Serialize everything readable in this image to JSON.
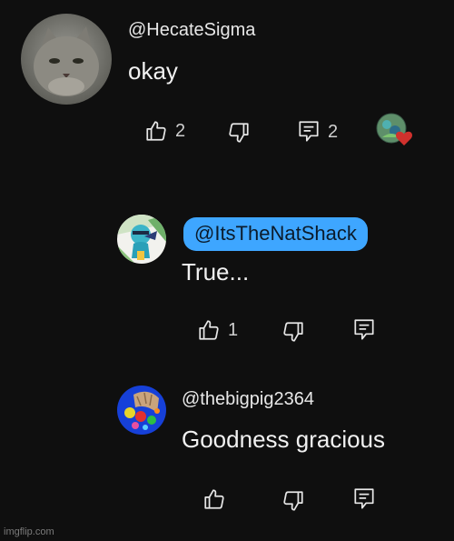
{
  "comments": [
    {
      "handle": "@HecateSigma",
      "text": "okay",
      "likes": "2",
      "replies": "2",
      "avatar": "cat-photo"
    },
    {
      "handle": "@ItsTheNatShack",
      "text": "True...",
      "likes": "1",
      "avatar": "cartoon-character"
    },
    {
      "handle": "@thebigpig2364",
      "text": "Goodness gracious",
      "likes": "",
      "avatar": "dots-and-creature"
    }
  ],
  "icons": {
    "like": "thumbs-up-icon",
    "dislike": "thumbs-down-icon",
    "reply": "comment-icon",
    "creator_heart": "creator-heart-icon"
  },
  "colors": {
    "background": "#0f0f0f",
    "mention_highlight": "#3ea6ff",
    "heart": "#d0312d"
  },
  "watermark": "imgflip.com"
}
